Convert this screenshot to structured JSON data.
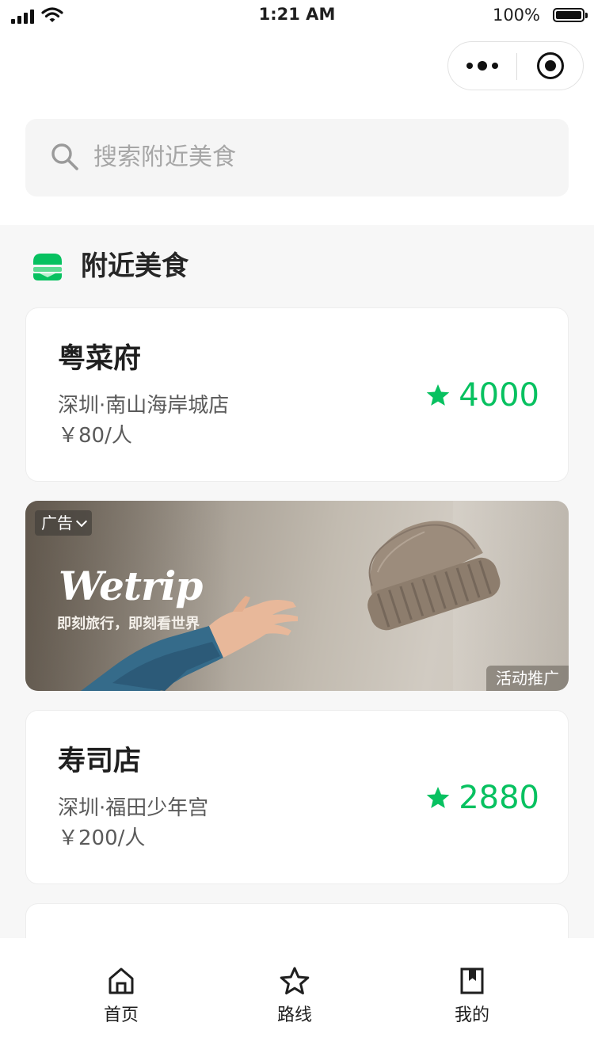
{
  "status_bar": {
    "time": "1:21 AM",
    "battery": "100%"
  },
  "search": {
    "placeholder": "搜索附近美食"
  },
  "section": {
    "title": "附近美食",
    "icon": "burger-icon"
  },
  "restaurants": [
    {
      "name": "粤菜府",
      "location": "深圳·南山海岸城店",
      "price": "￥80/人",
      "rating": "4000"
    },
    {
      "name": "寿司店",
      "location": "深圳·福田少年宫",
      "price": "￥200/人",
      "rating": "2880"
    }
  ],
  "ad": {
    "tag": "广告",
    "brand": "Wetrip",
    "slogan": "即刻旅行，即刻看世界",
    "label": "活动推广"
  },
  "tabs": [
    {
      "label": "首页",
      "icon": "home-icon"
    },
    {
      "label": "路线",
      "icon": "star-icon"
    },
    {
      "label": "我的",
      "icon": "bookmark-icon"
    }
  ],
  "colors": {
    "accent": "#07c160",
    "background": "#f7f7f7",
    "card": "#ffffff"
  }
}
